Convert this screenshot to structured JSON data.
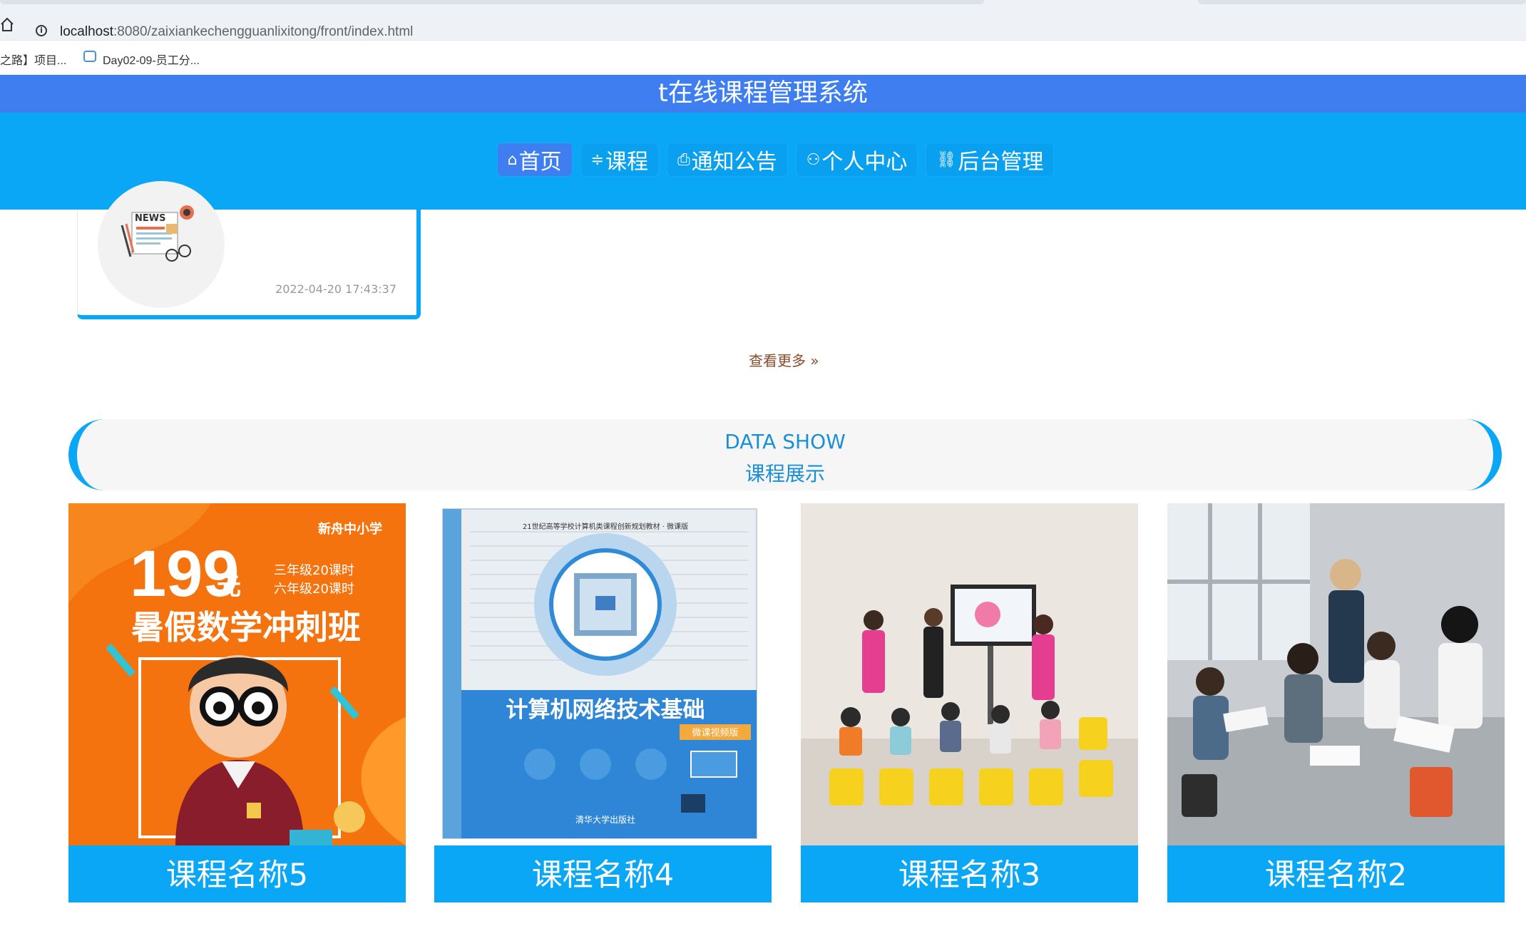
{
  "browser": {
    "url_host": "localhost",
    "url_rest": ":8080/zaixiankechengguanlixitong/front/index.html",
    "bookmarks": [
      "之路】项目...",
      "Day02-09-员工分..."
    ]
  },
  "site": {
    "title": "t在线课程管理系统",
    "nav": [
      {
        "icon": "⌂",
        "label": "首页"
      },
      {
        "icon": "≑",
        "label": "课程"
      },
      {
        "icon": "⎙",
        "label": "通知公告"
      },
      {
        "icon": "⚇",
        "label": "个人中心"
      },
      {
        "icon": "⛓",
        "label": "后台管理"
      }
    ]
  },
  "news": {
    "thumb_label": "NEWS",
    "date": "2022-04-20 17:43:37",
    "more_label": "查看更多"
  },
  "courses_section": {
    "title_en": "DATA SHOW",
    "title_cn": "课程展示",
    "items": [
      {
        "name": "课程名称5",
        "poster": {
          "price": "199",
          "unit": "元",
          "line1": "三年级20课时",
          "line2": "六年级20课时",
          "headline": "暑假数学冲刺班",
          "brand": "新舟中小学"
        }
      },
      {
        "name": "课程名称4",
        "book": {
          "series": "21世纪高等学校计算机类课程创新规划教材 · 微课版",
          "title": "计算机网络技术基础",
          "tag": "微课视频版",
          "publisher": "清华大学出版社"
        }
      },
      {
        "name": "课程名称3"
      },
      {
        "name": "课程名称2"
      }
    ]
  },
  "colors": {
    "primary": "#3e7ef0",
    "nav_bg": "#0aa7f7",
    "banner_text": "#1a8fd8"
  }
}
